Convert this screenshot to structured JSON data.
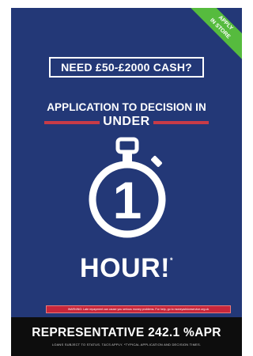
{
  "corner_badge": {
    "line1": "APPLY",
    "line2": "IN STORE"
  },
  "cash_box": {
    "text": "NEED £50-£2000 CASH?"
  },
  "headline": {
    "line1": "APPLICATION TO DECISION IN",
    "line2": "UNDER"
  },
  "stopwatch": {
    "digit": "1"
  },
  "hour": {
    "text": "HOUR!",
    "asterisk": "*"
  },
  "warning": {
    "text": "WARNING: Late repayment can cause you serious money problems. For help, go to moneyadviceservice.org.uk"
  },
  "footer": {
    "apr": "REPRESENTATIVE 242.1 %APR",
    "small": "LOANS SUBJECT TO STATUS. T&CS APPLY. *TYPICAL APPLICATION AND DECISION TIMES."
  },
  "colors": {
    "background": "#233877",
    "accent_red": "#c83b47",
    "badge_green": "#56bb3e",
    "footer": "#0d0d0d"
  }
}
